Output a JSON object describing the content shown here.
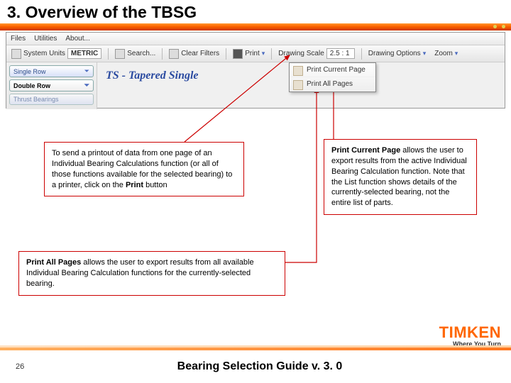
{
  "slide": {
    "title": "3. Overview of the TBSG",
    "page_number": "26",
    "doc_title": "Bearing Selection Guide v. 3. 0",
    "brand": "TIMKEN",
    "tagline": "Where You Turn"
  },
  "app": {
    "menus": [
      "Files",
      "Utilities",
      "About..."
    ],
    "toolbar": {
      "system_units_label": "System Units",
      "system_units_value": "METRIC",
      "search_label": "Search...",
      "clear_filters_label": "Clear Filters",
      "print_label": "Print",
      "drawing_scale_label": "Drawing Scale",
      "drawing_scale_value": "2.5 : 1",
      "drawing_options_label": "Drawing Options",
      "zoom_label": "Zoom"
    },
    "sidebar": {
      "items": [
        {
          "label": "Single Row"
        },
        {
          "label": "Double Row"
        },
        {
          "label": "Thrust Bearings"
        }
      ]
    },
    "content_heading": "TS - Tapered Single",
    "print_menu": {
      "item1": "Print Current Page",
      "item2": "Print All Pages"
    }
  },
  "callouts": {
    "c1_a": "To send a printout of data from one page of an Individual Bearing Calculations function (or all of those functions available for the selected bearing) to a printer, click on the ",
    "c1_b": "Print",
    "c1_c": " button",
    "c2_a": "Print Current Page",
    "c2_b": " allows the user to export results from the active Individual Bearing Calculation function. Note that the List function shows details of the currently-selected bearing, not the entire list of parts.",
    "c3_a": "Print All Pages",
    "c3_b": " allows the user to export results from all available Individual Bearing Calculation functions for the currently-selected bearing."
  }
}
